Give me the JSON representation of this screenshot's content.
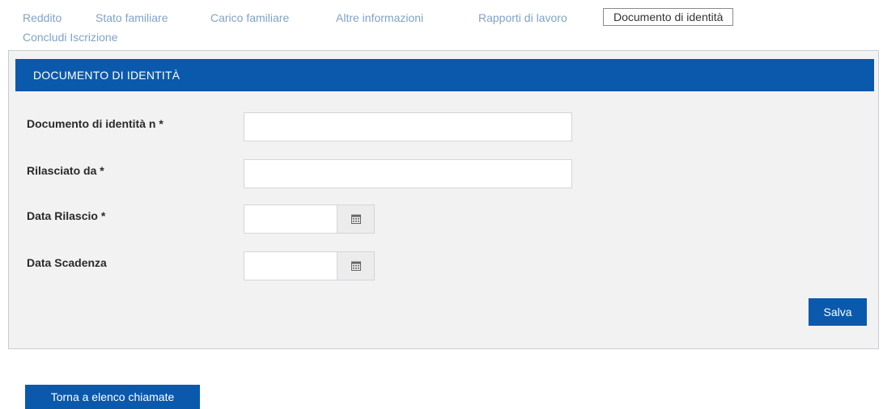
{
  "tabs": [
    {
      "label": "Reddito"
    },
    {
      "label": "Stato familiare"
    },
    {
      "label": "Carico familiare"
    },
    {
      "label": "Altre informazioni"
    },
    {
      "label": "Rapporti di lavoro"
    },
    {
      "label": "Documento di identità"
    },
    {
      "label": "Concludi Iscrizione"
    }
  ],
  "active_tab": "Documento di identità",
  "panel": {
    "title": "DOCUMENTO DI IDENTITÀ",
    "fields": {
      "doc_number": {
        "label": "Documento di identità n *",
        "value": ""
      },
      "issued_by": {
        "label": "Rilasciato da *",
        "value": ""
      },
      "issue_date": {
        "label": "Data Rilascio *",
        "value": ""
      },
      "expiry_date": {
        "label": "Data Scadenza",
        "value": ""
      }
    },
    "save_label": "Salva"
  },
  "back_button_label": "Torna a elenco chiamate",
  "icons": {
    "calendar": "calendar-icon"
  },
  "colors": {
    "primary": "#0b59ac",
    "tab_link": "#7fa3c8",
    "panel_bg": "#f2f2f3"
  }
}
